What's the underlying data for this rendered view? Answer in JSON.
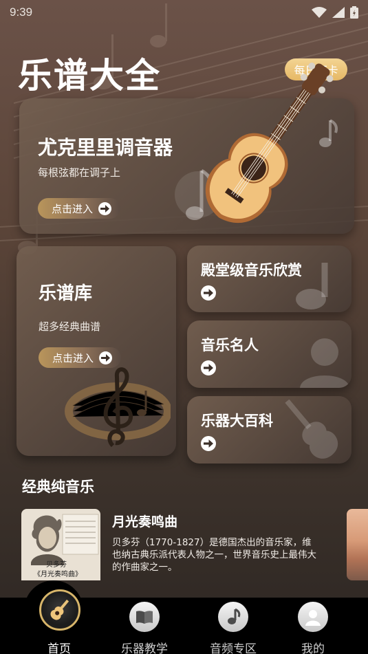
{
  "status_bar": {
    "time": "9:39"
  },
  "header": {
    "title": "乐谱大全",
    "checkin_label": "每日打卡"
  },
  "tuner_card": {
    "title": "尤克里里调音器",
    "subtitle": "每根弦都在调子上",
    "button_label": "点击进入"
  },
  "sheet_card": {
    "title": "乐谱库",
    "subtitle": "超多经典曲谱",
    "button_label": "点击进入"
  },
  "side_cards": [
    {
      "title": "殿堂级音乐欣赏"
    },
    {
      "title": "音乐名人"
    },
    {
      "title": "乐器大百科"
    }
  ],
  "section": {
    "title": "经典纯音乐"
  },
  "music_list": [
    {
      "title": "月光奏鸣曲",
      "description": "贝多芬（1770-1827）是德国杰出的音乐家，维也纳古典乐派代表人物之一，世界音乐史上最伟大的作曲家之一。",
      "cover_caption_1": "贝多芬",
      "cover_caption_2": "《月光奏鸣曲》"
    }
  ],
  "bottom_nav": [
    {
      "label": "首页",
      "icon": "guitar-icon",
      "active": true
    },
    {
      "label": "乐器教学",
      "icon": "book-icon",
      "active": false
    },
    {
      "label": "音频专区",
      "icon": "music-note-icon",
      "active": false
    },
    {
      "label": "我的",
      "icon": "user-icon",
      "active": false
    }
  ],
  "colors": {
    "accent_gold": "#e6b865",
    "nav_bg": "#000000",
    "active_nav": "#ffffff"
  }
}
